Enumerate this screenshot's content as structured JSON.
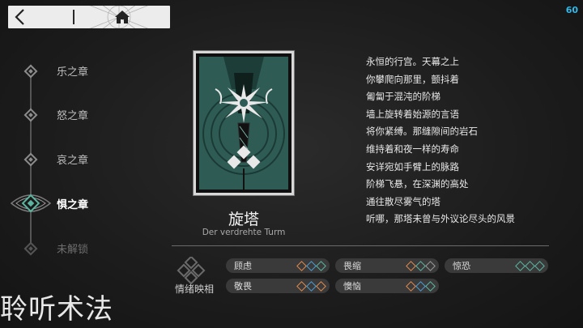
{
  "top_bar": {
    "back_icon": "chevron-left-icon",
    "home_icon": "home-icon"
  },
  "fps": "60",
  "chapters": [
    {
      "label": "乐之章",
      "state": "normal"
    },
    {
      "label": "怒之章",
      "state": "normal"
    },
    {
      "label": "哀之章",
      "state": "normal"
    },
    {
      "label": "惧之章",
      "state": "active"
    },
    {
      "label": "未解锁",
      "state": "locked"
    }
  ],
  "card": {
    "title": "旋塔",
    "subtitle": "Der verdrehte Turm"
  },
  "poem": [
    "永恒的行宫。天幕之上",
    "你攀爬向那里，颤抖着",
    "匍匐于混沌的阶梯",
    "墙上旋转着始源的言语",
    "将你紧缚。那缝隙间的岩石",
    "维持着和夜一样的寿命",
    "安详宛如手臂上的脉路",
    "阶梯飞悬，在深渊的高处",
    "通往散尽雾气的塔",
    "听哪，那塔未曾与外议论尽头的风景"
  ],
  "emotion": {
    "label": "情绪映相",
    "tags": [
      {
        "label": "顾虑",
        "dots": [
          "orange",
          "blue",
          "teal"
        ]
      },
      {
        "label": "畏缩",
        "dots": [
          "orange",
          "teal",
          "gray"
        ]
      },
      {
        "label": "惊恐",
        "dots": [
          "teal",
          "teal",
          "teal"
        ]
      },
      {
        "label": "敬畏",
        "dots": [
          "orange",
          "blue",
          "orange"
        ]
      },
      {
        "label": "懊恼",
        "dots": [
          "orange",
          "blue",
          "teal"
        ]
      }
    ]
  },
  "watermark": "聆听术法",
  "colors": {
    "accent_teal": "#5bb5a0",
    "card_green": "#2e5c55",
    "fps_blue": "#33b8e8"
  }
}
